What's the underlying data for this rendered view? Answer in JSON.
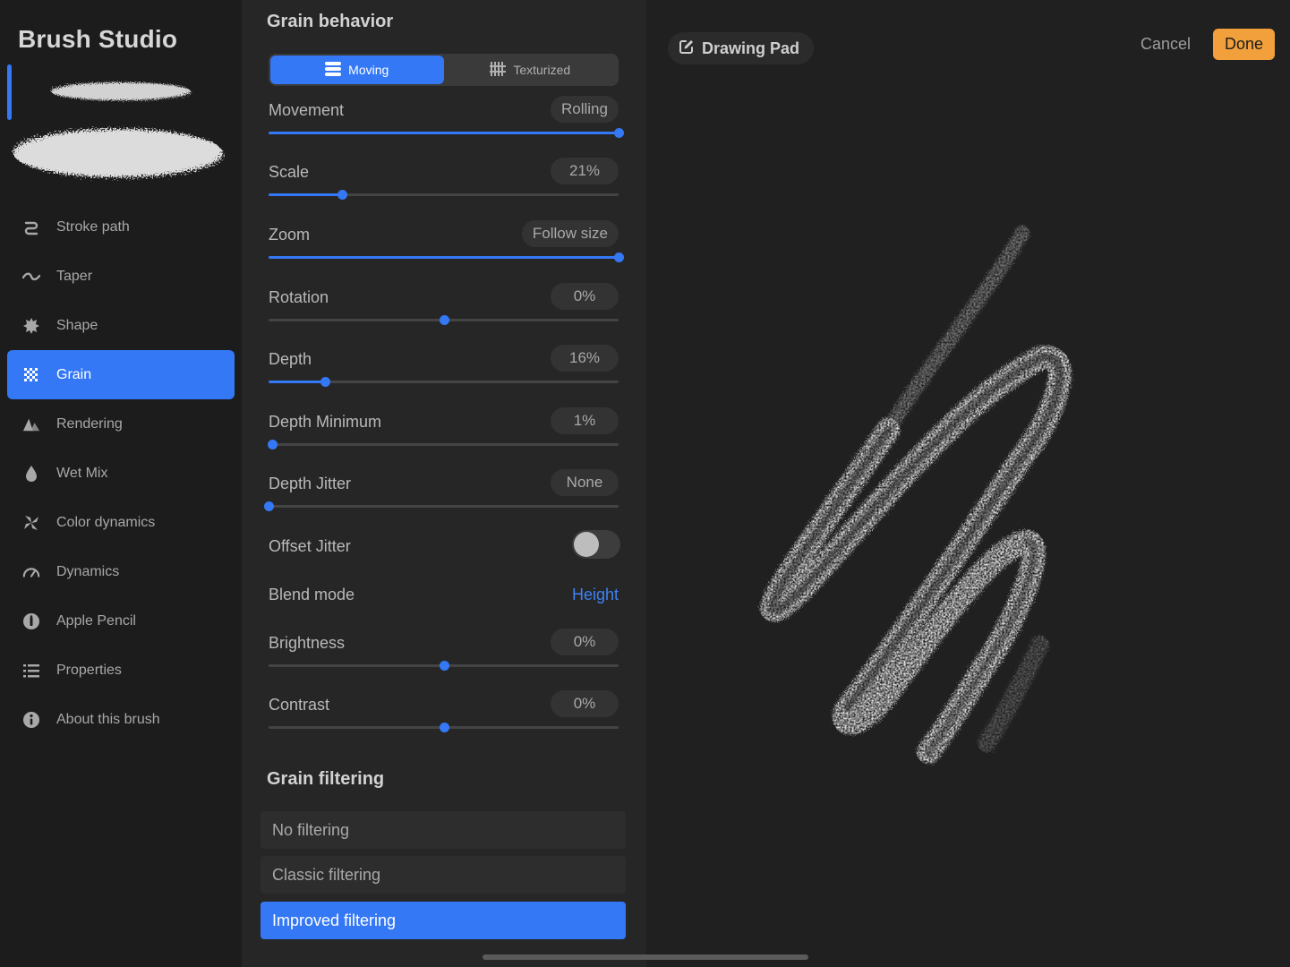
{
  "sidebar": {
    "title": "Brush Studio",
    "items": [
      {
        "label": "Stroke path",
        "icon": "stroke-path-icon",
        "active": false
      },
      {
        "label": "Taper",
        "icon": "taper-icon",
        "active": false
      },
      {
        "label": "Shape",
        "icon": "shape-icon",
        "active": false
      },
      {
        "label": "Grain",
        "icon": "grain-icon",
        "active": true
      },
      {
        "label": "Rendering",
        "icon": "rendering-icon",
        "active": false
      },
      {
        "label": "Wet Mix",
        "icon": "wet-mix-icon",
        "active": false
      },
      {
        "label": "Color dynamics",
        "icon": "color-dynamics-icon",
        "active": false
      },
      {
        "label": "Dynamics",
        "icon": "dynamics-icon",
        "active": false
      },
      {
        "label": "Apple Pencil",
        "icon": "apple-pencil-icon",
        "active": false
      },
      {
        "label": "Properties",
        "icon": "properties-icon",
        "active": false
      },
      {
        "label": "About this brush",
        "icon": "info-icon",
        "active": false
      }
    ]
  },
  "panel": {
    "behavior_title": "Grain behavior",
    "modes": [
      {
        "label": "Moving",
        "icon": "moving-icon",
        "active": true
      },
      {
        "label": "Texturized",
        "icon": "texturized-icon",
        "active": false
      }
    ],
    "sliders": {
      "movement": {
        "label": "Movement",
        "value": "Rolling",
        "level": 1.0
      },
      "scale": {
        "label": "Scale",
        "value": "21%",
        "level": 0.21
      },
      "zoom": {
        "label": "Zoom",
        "value": "Follow size",
        "level": 1.0
      },
      "rotation": {
        "label": "Rotation",
        "value": "0%",
        "level": 0.5
      },
      "depth": {
        "label": "Depth",
        "value": "16%",
        "level": 0.16
      },
      "depth_minimum": {
        "label": "Depth Minimum",
        "value": "1%",
        "level": 0.01
      },
      "depth_jitter": {
        "label": "Depth Jitter",
        "value": "None",
        "level": 0.0
      },
      "brightness": {
        "label": "Brightness",
        "value": "0%",
        "level": 0.5
      },
      "contrast": {
        "label": "Contrast",
        "value": "0%",
        "level": 0.5
      }
    },
    "offset_jitter": {
      "label": "Offset Jitter",
      "on": false
    },
    "blend_mode": {
      "label": "Blend mode",
      "value": "Height"
    },
    "filtering_title": "Grain filtering",
    "filters": [
      {
        "label": "No filtering",
        "active": false
      },
      {
        "label": "Classic filtering",
        "active": false
      },
      {
        "label": "Improved filtering",
        "active": true
      }
    ]
  },
  "canvas": {
    "pad_label": "Drawing Pad",
    "cancel_label": "Cancel",
    "done_label": "Done"
  },
  "colors": {
    "accent": "#3478f6",
    "done": "#f1a03c",
    "blend_text": "#3c82f6"
  }
}
